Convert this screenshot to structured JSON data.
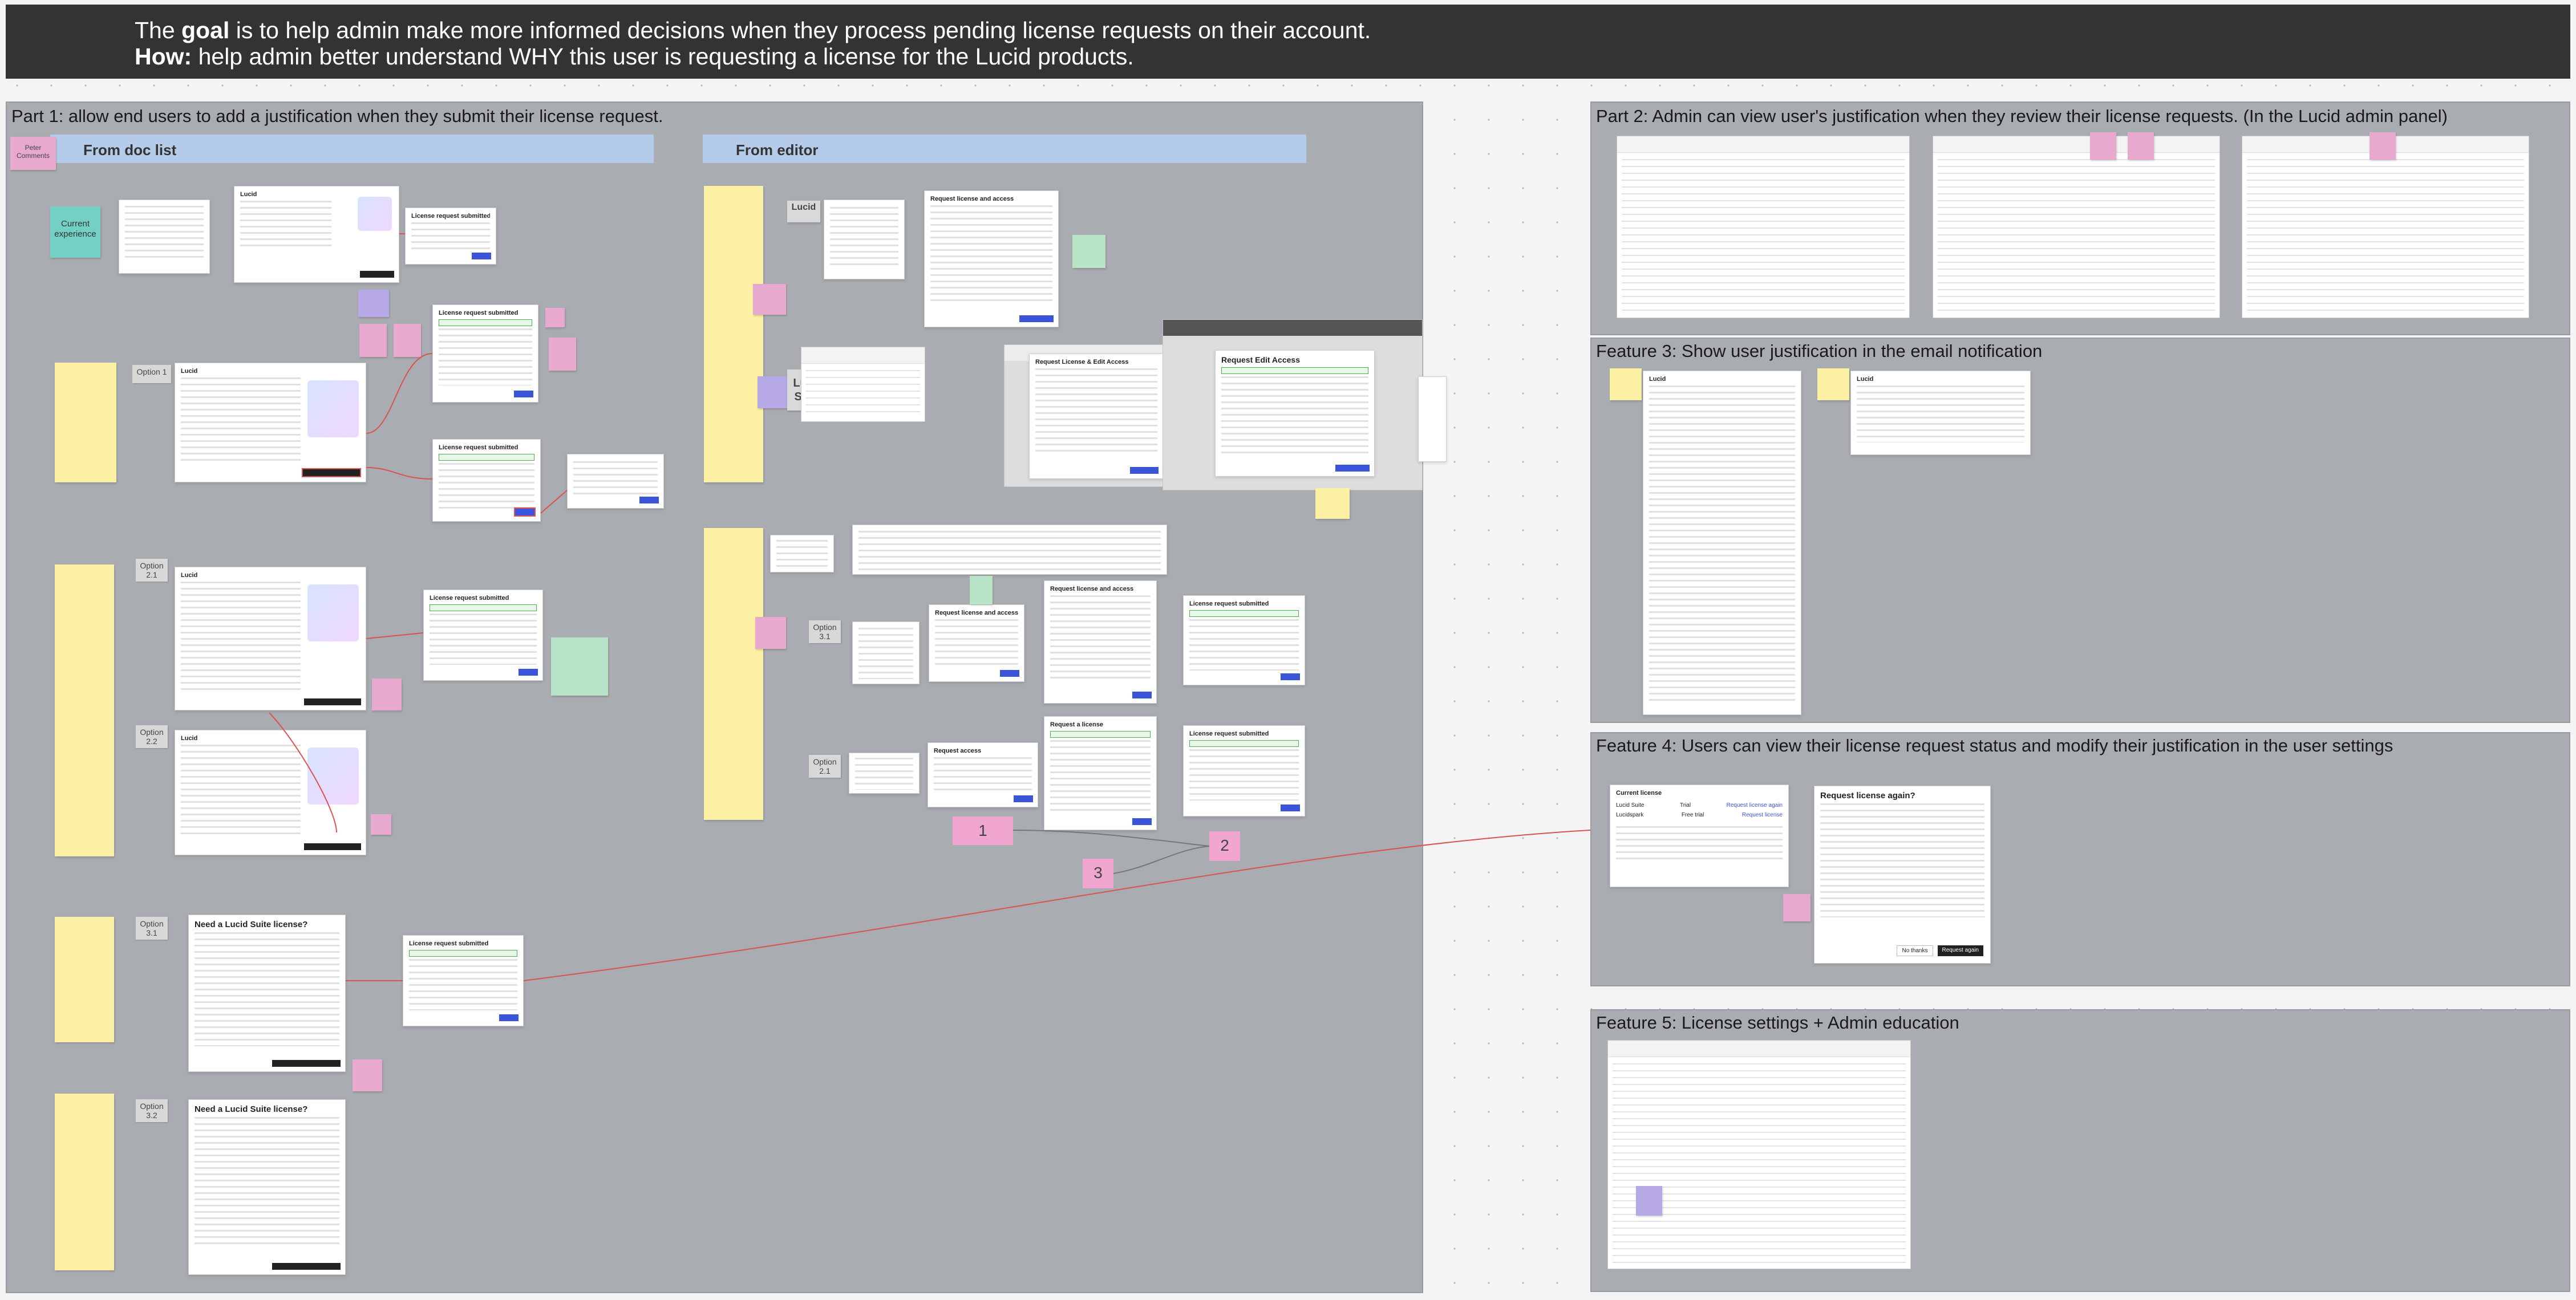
{
  "header": {
    "goal_prefix": "The ",
    "goal_bold": "goal",
    "goal_rest": " is to help admin make more informed decisions when they process pending license requests on their account.",
    "how_bold": "How:",
    "how_rest": " help admin better understand WHY this user is requesting a license for the Lucid products."
  },
  "part1": {
    "title": "Part 1: allow end users to add a justification when they submit their license request.",
    "lane_doc_list": "From doc list",
    "lane_editor": "From editor",
    "peter_comments": "Peter Comments",
    "current_experience": "Current experience",
    "options": {
      "option1": "Option 1",
      "option21": "Option 2.1",
      "option22": "Option 2.2",
      "option31": "Option 3.1",
      "option32": "Option 3.2",
      "option31_editor": "Option 3.1",
      "option21_editor": "Option 2.1"
    },
    "lucid_logo": "Lucid",
    "lucid_suite": "Lucid Suite",
    "badges": {
      "one": "1",
      "two": "2",
      "three": "3"
    },
    "modal_titles": {
      "need_suite_1": "Need a Lucid Suite license?",
      "need_suite_2": "Need a Lucid Suite license?",
      "license_submitted": "License request submitted",
      "request_license_access": "Request license and access",
      "request_license_edit": "Request License & Edit Access",
      "request_edit_access": "Request Edit Access",
      "request_a_license": "Request a license",
      "request_access": "Request access",
      "lucid_card": "Lucid"
    }
  },
  "part2": {
    "title": "Part 2: Admin can view user's justification when they review their license requests. (In the Lucid admin panel)"
  },
  "feature3": {
    "title": "Feature 3: Show user justification in the email notification",
    "email_heading": "Lucid"
  },
  "feature4": {
    "title": "Feature 4: Users can view their license request status and modify their justification in the user settings",
    "current_license": "Current license",
    "row1_product": "Lucid Suite",
    "row1_status": "Trial",
    "row2_product": "Lucidspark",
    "row2_status": "Free trial",
    "row1_link": "Request license again",
    "row2_link": "Request license",
    "modal_title": "Request license again?",
    "btn_no": "No thanks",
    "btn_yes": "Request again"
  },
  "feature5": {
    "title": "Feature 5: License settings + Admin education"
  },
  "colors": {
    "banner": "#333335",
    "section": "#a9acb0",
    "lane": "#b4cbe9",
    "sticky_yellow": "#fbf0a3",
    "sticky_pink": "#e8a9cf",
    "accent_blue": "#3a55d9",
    "connector": "#d9534f"
  }
}
